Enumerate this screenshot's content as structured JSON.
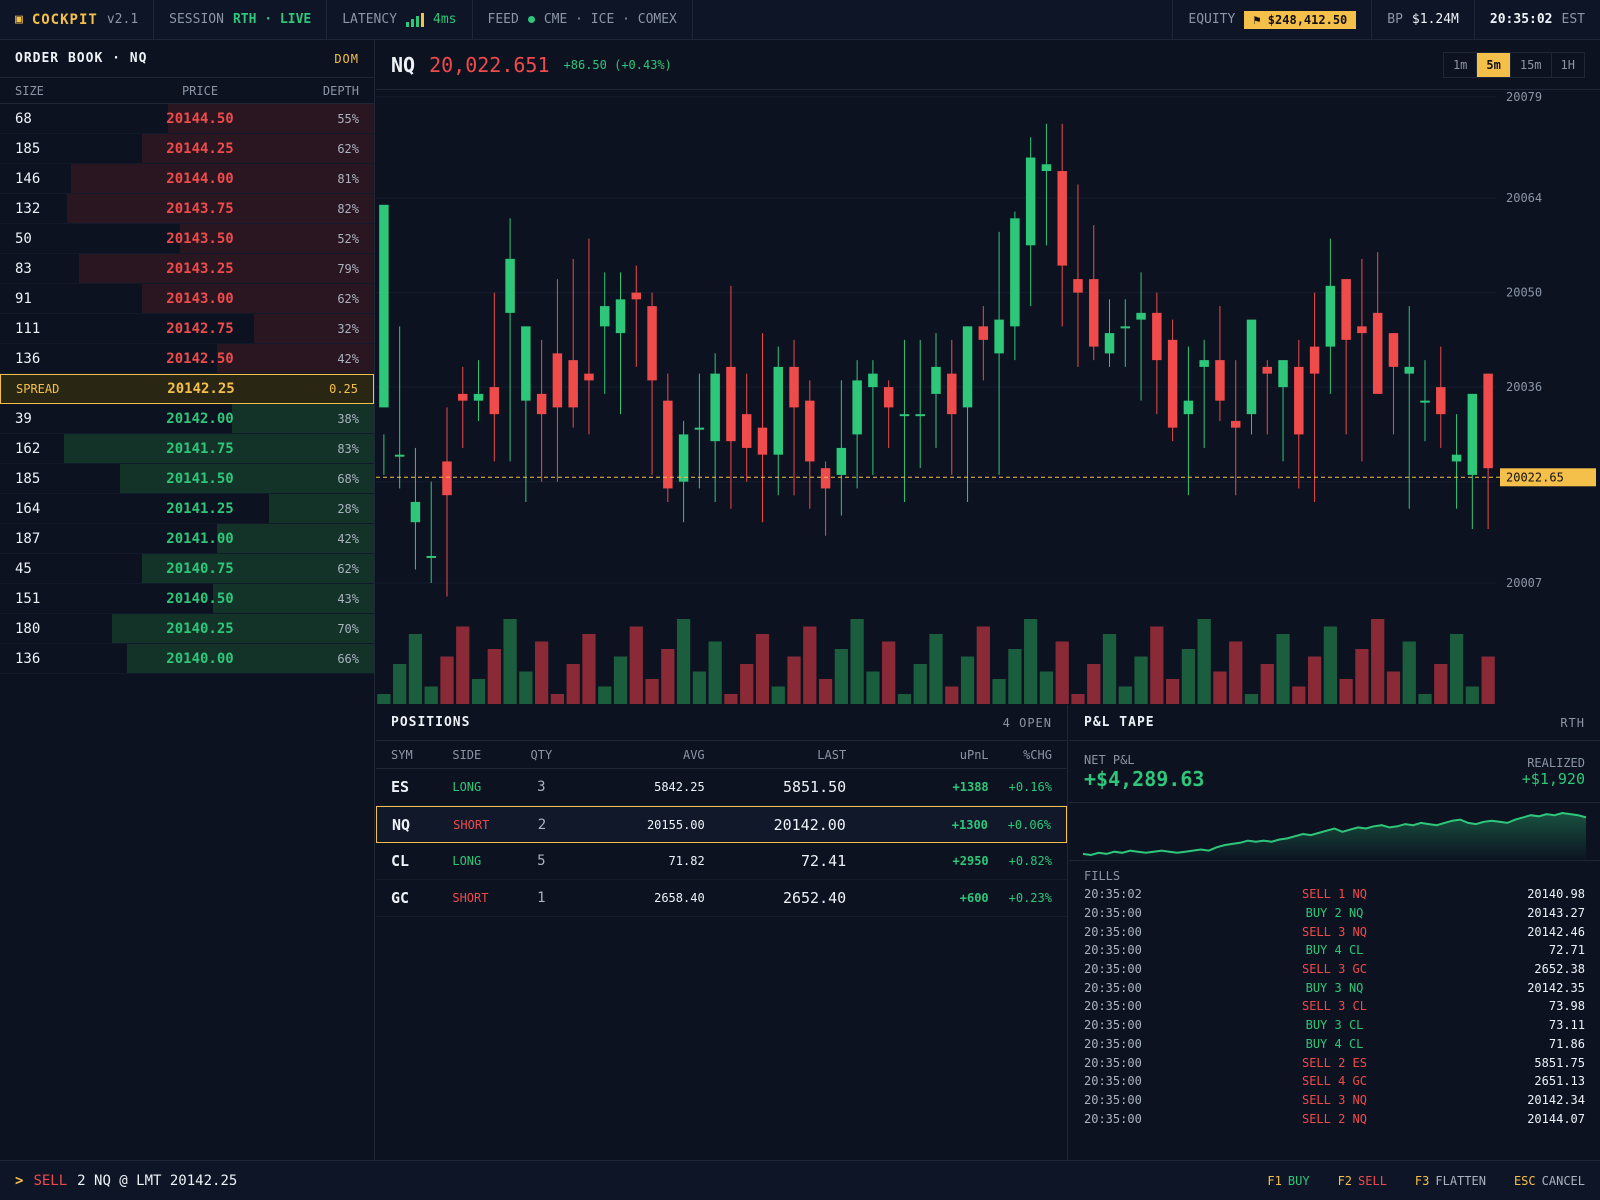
{
  "topbar": {
    "brand": "COCKPIT",
    "version": "v2.1",
    "session_label": "SESSION",
    "session_value": "RTH · LIVE",
    "latency_label": "LATENCY",
    "latency_value": "4ms",
    "feed_label": "FEED",
    "feed_value": "CME · ICE · COMEX",
    "equity_label": "EQUITY",
    "equity_value": "⚑ $248,412.50",
    "bp_label": "BP",
    "bp_value": "$1.24M",
    "clock": "20:35:02",
    "tz": "EST"
  },
  "orderbook": {
    "title": "ORDER BOOK · NQ",
    "mode": "DOM",
    "headers": [
      "SIZE",
      "PRICE",
      "DEPTH"
    ],
    "asks": [
      {
        "size": "68",
        "price": "20144.50",
        "depth": "55%",
        "pct": 55
      },
      {
        "size": "185",
        "price": "20144.25",
        "depth": "62%",
        "pct": 62
      },
      {
        "size": "146",
        "price": "20144.00",
        "depth": "81%",
        "pct": 81
      },
      {
        "size": "132",
        "price": "20143.75",
        "depth": "82%",
        "pct": 82
      },
      {
        "size": "50",
        "price": "20143.50",
        "depth": "52%",
        "pct": 52
      },
      {
        "size": "83",
        "price": "20143.25",
        "depth": "79%",
        "pct": 79
      },
      {
        "size": "91",
        "price": "20143.00",
        "depth": "62%",
        "pct": 62
      },
      {
        "size": "111",
        "price": "20142.75",
        "depth": "32%",
        "pct": 32
      },
      {
        "size": "136",
        "price": "20142.50",
        "depth": "42%",
        "pct": 42
      }
    ],
    "spread_label": "SPREAD",
    "spread_price": "20142.25",
    "spread_value": "0.25",
    "bids": [
      {
        "size": "39",
        "price": "20142.00",
        "depth": "38%",
        "pct": 38
      },
      {
        "size": "162",
        "price": "20141.75",
        "depth": "83%",
        "pct": 83
      },
      {
        "size": "185",
        "price": "20141.50",
        "depth": "68%",
        "pct": 68
      },
      {
        "size": "164",
        "price": "20141.25",
        "depth": "28%",
        "pct": 28
      },
      {
        "size": "187",
        "price": "20141.00",
        "depth": "42%",
        "pct": 42
      },
      {
        "size": "45",
        "price": "20140.75",
        "depth": "62%",
        "pct": 62
      },
      {
        "size": "151",
        "price": "20140.50",
        "depth": "43%",
        "pct": 43
      },
      {
        "size": "180",
        "price": "20140.25",
        "depth": "70%",
        "pct": 70
      },
      {
        "size": "136",
        "price": "20140.00",
        "depth": "66%",
        "pct": 66
      }
    ]
  },
  "chart_header": {
    "symbol": "NQ",
    "last": "20,022.651",
    "change": "+86.50 (+0.43%)",
    "timeframes": [
      "1m",
      "5m",
      "15m",
      "1H"
    ],
    "active_timeframe": "5m"
  },
  "chart_data": {
    "type": "candlestick",
    "y_ticks": [
      20079,
      20064,
      20050,
      20036,
      20022,
      20007
    ],
    "ylim": [
      20003,
      20080
    ],
    "last_price_label": "20022.65",
    "last_price": 20022.65,
    "candles": [
      [
        20033,
        20063,
        20029,
        20023
      ],
      [
        20026,
        20026,
        20045,
        20021
      ],
      [
        20016,
        20019,
        20027,
        20009
      ],
      [
        20011,
        20011,
        20022,
        20007
      ],
      [
        20025,
        20020,
        20033,
        20005
      ],
      [
        20035,
        20034,
        20039,
        20027
      ],
      [
        20034,
        20035,
        20040,
        20031
      ],
      [
        20036,
        20032,
        20050,
        20025
      ],
      [
        20047,
        20055,
        20061,
        20025
      ],
      [
        20034,
        20045,
        20045,
        20019
      ],
      [
        20035,
        20032,
        20043,
        20022
      ],
      [
        20041,
        20033,
        20052,
        20022
      ],
      [
        20040,
        20033,
        20055,
        20030
      ],
      [
        20038,
        20037,
        20058,
        20029
      ],
      [
        20045,
        20048,
        20053,
        20035
      ],
      [
        20044,
        20049,
        20053,
        20032
      ],
      [
        20050,
        20049,
        20054,
        20039
      ],
      [
        20048,
        20037,
        20050,
        20023
      ],
      [
        20034,
        20021,
        20038,
        20019
      ],
      [
        20022,
        20029,
        20031,
        20016
      ],
      [
        20030,
        20030,
        20038,
        20021
      ],
      [
        20028,
        20038,
        20041,
        20019
      ],
      [
        20039,
        20028,
        20051,
        20018
      ],
      [
        20032,
        20027,
        20038,
        20022
      ],
      [
        20030,
        20026,
        20044,
        20016
      ],
      [
        20026,
        20039,
        20042,
        20020
      ],
      [
        20039,
        20033,
        20043,
        20020
      ],
      [
        20034,
        20025,
        20037,
        20018
      ],
      [
        20024,
        20021,
        20025,
        20014
      ],
      [
        20023,
        20027,
        20037,
        20017
      ],
      [
        20029,
        20037,
        20040,
        20021
      ],
      [
        20036,
        20038,
        20040,
        20023
      ],
      [
        20036,
        20033,
        20037,
        20027
      ],
      [
        20032,
        20032,
        20043,
        20019
      ],
      [
        20032,
        20032,
        20043,
        20024
      ],
      [
        20035,
        20039,
        20044,
        20027
      ],
      [
        20038,
        20032,
        20043,
        20023
      ],
      [
        20033,
        20045,
        20045,
        20019
      ],
      [
        20045,
        20043,
        20048,
        20037
      ],
      [
        20041,
        20046,
        20059,
        20023
      ],
      [
        20045,
        20061,
        20062,
        20040
      ],
      [
        20057,
        20070,
        20073,
        20048
      ],
      [
        20068,
        20069,
        20075,
        20057
      ],
      [
        20068,
        20054,
        20075,
        20045
      ],
      [
        20052,
        20050,
        20066,
        20039
      ],
      [
        20052,
        20042,
        20060,
        20040
      ],
      [
        20041,
        20044,
        20049,
        20039
      ],
      [
        20045,
        20045,
        20049,
        20039
      ],
      [
        20046,
        20047,
        20053,
        20034
      ],
      [
        20047,
        20040,
        20050,
        20032
      ],
      [
        20043,
        20030,
        20046,
        20028
      ],
      [
        20032,
        20034,
        20042,
        20020
      ],
      [
        20039,
        20040,
        20043,
        20027
      ],
      [
        20040,
        20034,
        20048,
        20031
      ],
      [
        20031,
        20030,
        20040,
        20020
      ],
      [
        20032,
        20046,
        20043,
        20029
      ],
      [
        20039,
        20038,
        20040,
        20029
      ],
      [
        20036,
        20040,
        20039,
        20025
      ],
      [
        20039,
        20029,
        20043,
        20021
      ],
      [
        20042,
        20038,
        20050,
        20019
      ],
      [
        20042,
        20051,
        20058,
        20035
      ],
      [
        20052,
        20043,
        20048,
        20029
      ],
      [
        20045,
        20044,
        20055,
        20025
      ],
      [
        20047,
        20035,
        20056,
        20037
      ],
      [
        20044,
        20039,
        20044,
        20029
      ],
      [
        20038,
        20039,
        20048,
        20018
      ],
      [
        20034,
        20034,
        20040,
        20028
      ],
      [
        20036,
        20032,
        20042,
        20027
      ],
      [
        20025,
        20026,
        20032,
        20018
      ],
      [
        20023,
        20035,
        20035,
        20015
      ],
      [
        20038,
        20024,
        20038,
        20015
      ]
    ],
    "volume_colors": [
      "#8a2a36",
      "#1a5e3e"
    ]
  },
  "positions": {
    "title": "POSITIONS",
    "count": "4 OPEN",
    "headers": [
      "SYM",
      "SIDE",
      "QTY",
      "AVG",
      "LAST",
      "uPnL",
      "%CHG"
    ],
    "rows": [
      {
        "sym": "ES",
        "side": "LONG",
        "qty": "3",
        "avg": "5842.25",
        "last": "5851.50",
        "upnl": "+1388",
        "pct": "+0.16%"
      },
      {
        "sym": "NQ",
        "side": "SHORT",
        "qty": "2",
        "avg": "20155.00",
        "last": "20142.00",
        "upnl": "+1300",
        "pct": "+0.06%"
      },
      {
        "sym": "CL",
        "side": "LONG",
        "qty": "5",
        "avg": "71.82",
        "last": "72.41",
        "upnl": "+2950",
        "pct": "+0.82%"
      },
      {
        "sym": "GC",
        "side": "SHORT",
        "qty": "1",
        "avg": "2658.40",
        "last": "2652.40",
        "upnl": "+600",
        "pct": "+0.23%"
      }
    ]
  },
  "pnl": {
    "title": "P&L TAPE",
    "session": "RTH",
    "net_label": "NET P&L",
    "net_value": "+$4,289.63",
    "realized_label": "REALIZED",
    "realized_value": "+$1,920",
    "spark": [
      10,
      9,
      11,
      10,
      12,
      11,
      13,
      12,
      11,
      12,
      13,
      12,
      11,
      12,
      13,
      14,
      13,
      16,
      18,
      19,
      20,
      22,
      21,
      22,
      21,
      23,
      24,
      26,
      28,
      27,
      29,
      31,
      33,
      30,
      32,
      34,
      33,
      35,
      36,
      34,
      35,
      37,
      36,
      38,
      37,
      36,
      38,
      40,
      41,
      38,
      37,
      39,
      40,
      39,
      38,
      41,
      43,
      45,
      44,
      46,
      45,
      47,
      46,
      45,
      43
    ],
    "fills_label": "FILLS",
    "fills": [
      {
        "time": "20:35:02",
        "desc": "SELL 1 NQ",
        "side": "sell",
        "price": "20140.98"
      },
      {
        "time": "20:35:00",
        "desc": "BUY 2 NQ",
        "side": "buy",
        "price": "20143.27"
      },
      {
        "time": "20:35:00",
        "desc": "SELL 3 NQ",
        "side": "sell",
        "price": "20142.46"
      },
      {
        "time": "20:35:00",
        "desc": "BUY 4 CL",
        "side": "buy",
        "price": "72.71"
      },
      {
        "time": "20:35:00",
        "desc": "SELL 3 GC",
        "side": "sell",
        "price": "2652.38"
      },
      {
        "time": "20:35:00",
        "desc": "BUY 3 NQ",
        "side": "buy",
        "price": "20142.35"
      },
      {
        "time": "20:35:00",
        "desc": "SELL 3 CL",
        "side": "sell",
        "price": "73.98"
      },
      {
        "time": "20:35:00",
        "desc": "BUY 3 CL",
        "side": "buy",
        "price": "73.11"
      },
      {
        "time": "20:35:00",
        "desc": "BUY 4 CL",
        "side": "buy",
        "price": "71.86"
      },
      {
        "time": "20:35:00",
        "desc": "SELL 2 ES",
        "side": "sell",
        "price": "5851.75"
      },
      {
        "time": "20:35:00",
        "desc": "SELL 4 GC",
        "side": "sell",
        "price": "2651.13"
      },
      {
        "time": "20:35:00",
        "desc": "SELL 3 NQ",
        "side": "sell",
        "price": "20142.34"
      },
      {
        "time": "20:35:00",
        "desc": "SELL 2 NQ",
        "side": "sell",
        "price": "20144.07"
      }
    ]
  },
  "command": {
    "prompt": ">",
    "side": "SELL",
    "rest": "2 NQ @ LMT 20142.25",
    "keys": [
      {
        "key": "F1",
        "label": "BUY"
      },
      {
        "key": "F2",
        "label": "SELL"
      },
      {
        "key": "F3",
        "label": "FLATTEN"
      },
      {
        "key": "ESC",
        "label": "CANCEL"
      }
    ]
  },
  "colors": {
    "up": "#2ec77a",
    "down": "#ef4b4b",
    "accent": "#f5c04a"
  }
}
